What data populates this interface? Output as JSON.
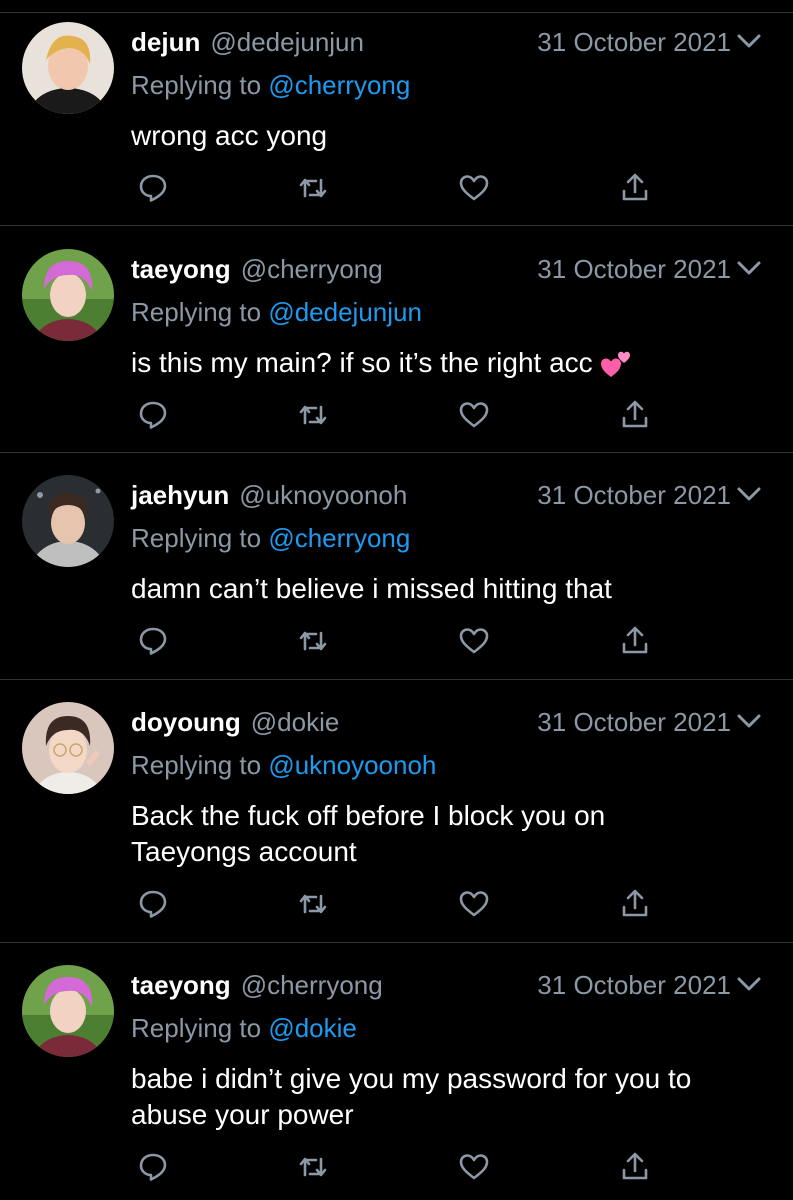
{
  "tweets": [
    {
      "display_name": "dejun",
      "handle": "@dedejunjun",
      "date": "31 October 2021",
      "replying_prefix": "Replying to",
      "replying_to": "@cherryong",
      "text": "wrong acc yong",
      "emoji": ""
    },
    {
      "display_name": "taeyong",
      "handle": "@cherryong",
      "date": "31 October 2021",
      "replying_prefix": "Replying to",
      "replying_to": "@dedejunjun",
      "text": "is this my main? if so it’s the right acc",
      "emoji": "two-hearts"
    },
    {
      "display_name": "jaehyun",
      "handle": "@uknoyoonoh",
      "date": "31 October 2021",
      "replying_prefix": "Replying to",
      "replying_to": "@cherryong",
      "text": "damn can’t believe i missed hitting that",
      "emoji": ""
    },
    {
      "display_name": "doyoung",
      "handle": "@dokie",
      "date": "31 October 2021",
      "replying_prefix": "Replying to",
      "replying_to": "@uknoyoonoh",
      "text": "Back the fuck off before I block you on Taeyongs account",
      "emoji": ""
    },
    {
      "display_name": "taeyong",
      "handle": "@cherryong",
      "date": "31 October 2021",
      "replying_prefix": "Replying to",
      "replying_to": "@dokie",
      "text": "babe i didn’t give you my password for you to abuse your power",
      "emoji": ""
    }
  ],
  "action_icons": [
    "reply-icon",
    "retweet-icon",
    "like-icon",
    "share-icon"
  ],
  "colors": {
    "background": "#000000",
    "primary_text": "#ffffff",
    "secondary_text": "#8b98a5",
    "mention": "#1d9bf0",
    "divider": "#2f3336"
  }
}
